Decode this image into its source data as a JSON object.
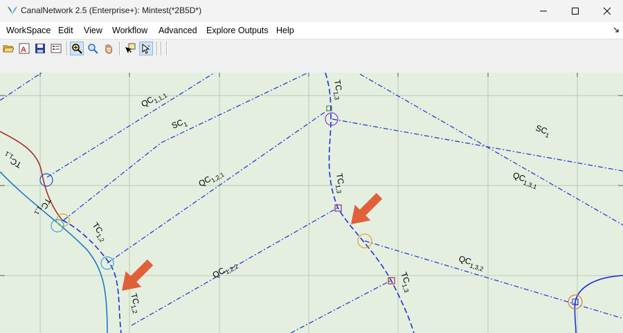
{
  "window": {
    "title": "CanalNetwork 2.5  (Enterprise+): Mintest(*2B5D*)"
  },
  "menu": [
    {
      "label": "WorkSpace"
    },
    {
      "label": "Edit"
    },
    {
      "label": "View"
    },
    {
      "label": "Workflow"
    },
    {
      "label": "Advanced"
    },
    {
      "label": "Explore Outputs"
    },
    {
      "label": "Help"
    }
  ],
  "toolbar": {
    "buttons": [
      {
        "icon": "open-folder-icon"
      },
      {
        "icon": "font-icon"
      },
      {
        "icon": "save-icon"
      },
      {
        "icon": "properties-icon"
      },
      {
        "icon": "zoom-in-icon"
      },
      {
        "icon": "zoom-icon"
      },
      {
        "icon": "pan-hand-icon"
      },
      {
        "icon": "node-select-icon"
      },
      {
        "icon": "pointer-select-icon"
      }
    ]
  },
  "map": {
    "labels": {
      "qc111": {
        "base": "QC",
        "sub": "1,1,1"
      },
      "sc1_left": {
        "base": "SC",
        "sub": "1"
      },
      "tc11": {
        "base": "TC",
        "sub": "1,1"
      },
      "tc11b": {
        "base": "TC",
        "sub": "1,1"
      },
      "qc121": {
        "base": "QC",
        "sub": "1,2,1"
      },
      "tc12": {
        "base": "TC",
        "sub": "1,2"
      },
      "tc12b": {
        "base": "TC",
        "sub": "1,2"
      },
      "qc122": {
        "base": "QC",
        "sub": "1,2,2"
      },
      "tc13_top": {
        "base": "TC",
        "sub": "1,3"
      },
      "tc13_mid": {
        "base": "TC",
        "sub": "1,3"
      },
      "tc13_bot": {
        "base": "TC",
        "sub": "1,3"
      },
      "sc1_right": {
        "base": "SC",
        "sub": "1"
      },
      "qc131": {
        "base": "QC",
        "sub": "1,3,1"
      },
      "qc132": {
        "base": "QC",
        "sub": "1,3,2"
      }
    },
    "colors": {
      "background": "#e4efe0",
      "grid": "#b9c8b5",
      "canal": "#1a2fd6",
      "river_red": "#b02a2a",
      "river_blue": "#1878c8",
      "arrow": "#e0603a"
    }
  }
}
